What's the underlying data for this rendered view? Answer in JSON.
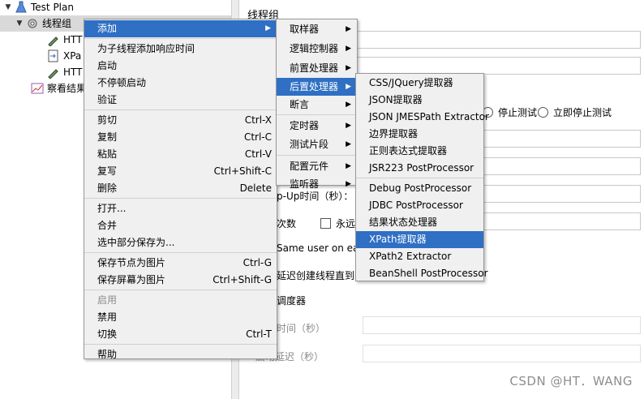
{
  "tree": {
    "test_plan": "Test Plan",
    "thread_group": "线程组",
    "http1": "HTT",
    "xpath": "XPa",
    "http2": "HTT",
    "results": "察看结果"
  },
  "panel": {
    "title": "线程组",
    "stop_test": "停止测试",
    "stop_now": "立即停止测试",
    "rampup": "p-Up时间（秒）：",
    "loops": "次数",
    "forever": "永远",
    "same_user": "Same user on each",
    "delay": "延迟创建线程直到",
    "scheduler": "调度器",
    "duration": "时间（秒）",
    "startup": "启动延迟（秒）"
  },
  "menu1": {
    "add": "添加",
    "add_resp": "为子线程添加响应时间",
    "start": "启动",
    "start_no_pause": "不停顿启动",
    "validate": "验证",
    "cut": "剪切",
    "cut_key": "Ctrl-X",
    "copy": "复制",
    "copy_key": "Ctrl-C",
    "paste": "粘贴",
    "paste_key": "Ctrl-V",
    "dup": "复写",
    "dup_key": "Ctrl+Shift-C",
    "del": "删除",
    "del_key": "Delete",
    "open": "打开...",
    "merge": "合并",
    "save_sel": "选中部分保存为...",
    "save_node": "保存节点为图片",
    "save_node_key": "Ctrl-G",
    "save_screen": "保存屏幕为图片",
    "save_screen_key": "Ctrl+Shift-G",
    "enable": "启用",
    "disable": "禁用",
    "toggle": "切换",
    "toggle_key": "Ctrl-T",
    "help": "帮助"
  },
  "menu2": {
    "sampler": "取样器",
    "logic": "逻辑控制器",
    "pre": "前置处理器",
    "post": "后置处理器",
    "assert": "断言",
    "timer": "定时器",
    "fragment": "测试片段",
    "config": "配置元件",
    "listener": "监听器"
  },
  "menu3": {
    "css": "CSS/JQuery提取器",
    "json": "JSON提取器",
    "jmes": "JSON JMESPath Extractor",
    "boundary": "边界提取器",
    "regex": "正则表达式提取器",
    "jsr223": "JSR223 PostProcessor",
    "debug": "Debug PostProcessor",
    "jdbc": "JDBC PostProcessor",
    "result_status": "结果状态处理器",
    "xpath": "XPath提取器",
    "xpath2": "XPath2 Extractor",
    "beanshell": "BeanShell PostProcessor"
  },
  "watermark": "CSDN @HT．WANG",
  "colors": {
    "highlight": "#2f6fc4",
    "menu_bg": "#f0f0f0"
  }
}
